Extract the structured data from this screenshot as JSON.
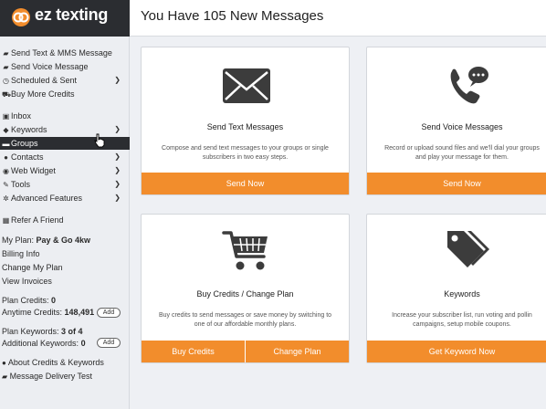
{
  "brand": {
    "logo_text": "ez texting",
    "accent_color": "#f28d2c",
    "sidebar_dark": "#2b2d31"
  },
  "sidebar": {
    "items": [
      {
        "icon": "message-icon",
        "label": "Send Text & MMS Message",
        "chevron": false
      },
      {
        "icon": "voice-icon",
        "label": "Send Voice Message",
        "chevron": false
      },
      {
        "icon": "clock-icon",
        "label": "Scheduled & Sent",
        "chevron": true
      },
      {
        "icon": "cart-icon",
        "label": "Buy More Credits",
        "chevron": false
      },
      {
        "icon": "inbox-icon",
        "label": "Inbox",
        "chevron": false
      },
      {
        "icon": "tag-icon",
        "label": "Keywords",
        "chevron": true
      },
      {
        "icon": "folder-icon",
        "label": "Groups",
        "chevron": false,
        "active": true
      },
      {
        "icon": "person-icon",
        "label": "Contacts",
        "chevron": true
      },
      {
        "icon": "globe-icon",
        "label": "Web Widget",
        "chevron": true
      },
      {
        "icon": "wrench-icon",
        "label": "Tools",
        "chevron": true
      },
      {
        "icon": "gear-icon",
        "label": "Advanced Features",
        "chevron": true
      },
      {
        "icon": "refer-icon",
        "label": "Refer A Friend",
        "chevron": false
      }
    ],
    "plan_label": "My Plan:",
    "plan_name": "Pay & Go 4kw",
    "links": [
      "Billing Info",
      "Change My Plan",
      "View Invoices"
    ],
    "plan_credits_label": "Plan Credits:",
    "plan_credits_value": "0",
    "anytime_credits_label": "Anytime Credits:",
    "anytime_credits_value": "148,491",
    "plan_keywords_label": "Plan Keywords:",
    "plan_keywords_value": "3 of 4",
    "additional_keywords_label": "Additional Keywords:",
    "additional_keywords_value": "0",
    "add_label": "Add",
    "bottom_links": [
      "About Credits & Keywords",
      "Message Delivery Test"
    ]
  },
  "header": {
    "title": "You Have 105 New Messages"
  },
  "cards": [
    {
      "icon": "envelope-icon",
      "title": "Send Text Messages",
      "desc": "Compose and send text messages to your groups or single subscribers in two easy steps.",
      "buttons": [
        "Send Now"
      ]
    },
    {
      "icon": "phone-icon",
      "title": "Send Voice Messages",
      "desc": "Record or upload sound files and we'll dial your groups and play your message for them.",
      "buttons": [
        "Send Now"
      ]
    },
    {
      "icon": "cart-large-icon",
      "title": "Buy Credits / Change Plan",
      "desc": "Buy credits to send messages or save money by switching to one of our affordable monthly plans.",
      "buttons": [
        "Buy Credits",
        "Change Plan"
      ]
    },
    {
      "icon": "tags-icon",
      "title": "Keywords",
      "desc": "Increase your subscriber list, run voting and pollin campaigns, setup mobile coupons.",
      "buttons": [
        "Get Keyword Now"
      ]
    }
  ]
}
